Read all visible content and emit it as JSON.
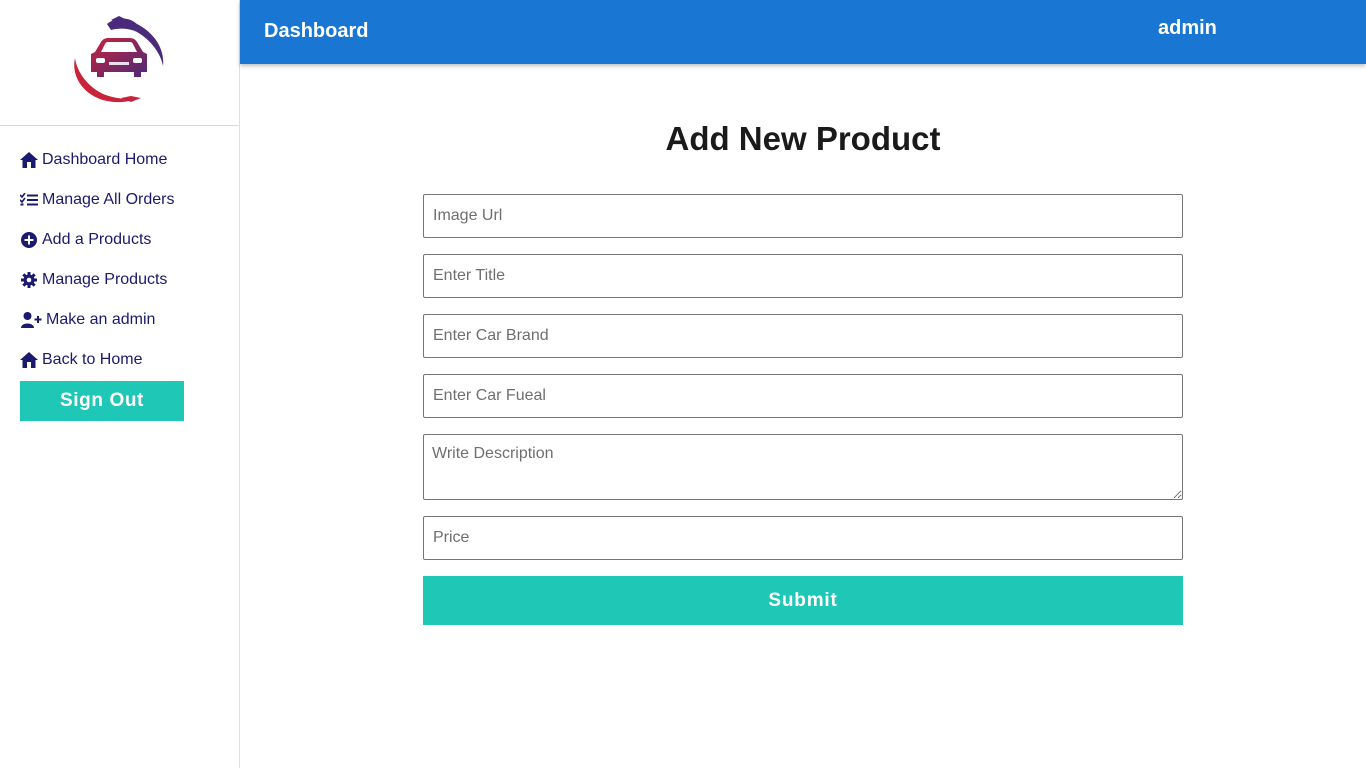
{
  "topbar": {
    "title": "Dashboard",
    "user": "admin"
  },
  "brand": {
    "logo_icon": "car-hands-logo"
  },
  "sidebar": {
    "items": [
      {
        "label": "Dashboard Home",
        "icon": "home-icon"
      },
      {
        "label": "Manage All Orders",
        "icon": "task-list-icon"
      },
      {
        "label": "Add a Products",
        "icon": "plus-circle-icon"
      },
      {
        "label": "Manage Products",
        "icon": "gear-icon"
      },
      {
        "label": "Make an admin",
        "icon": "user-plus-icon"
      },
      {
        "label": "Back to Home",
        "icon": "home-icon"
      }
    ],
    "signout_label": "Sign Out"
  },
  "form": {
    "title": "Add New Product",
    "image_url_placeholder": "Image Url",
    "title_placeholder": "Enter Title",
    "brand_placeholder": "Enter Car Brand",
    "fuel_placeholder": "Enter Car Fueal",
    "description_placeholder": "Write Description",
    "price_placeholder": "Price",
    "submit_label": "Submit"
  },
  "colors": {
    "topbar": "#1976d2",
    "accent": "#1fc7b6",
    "nav_text": "#1a1a6e",
    "logo_red": "#c8233a",
    "logo_purple": "#4a2a7a"
  }
}
